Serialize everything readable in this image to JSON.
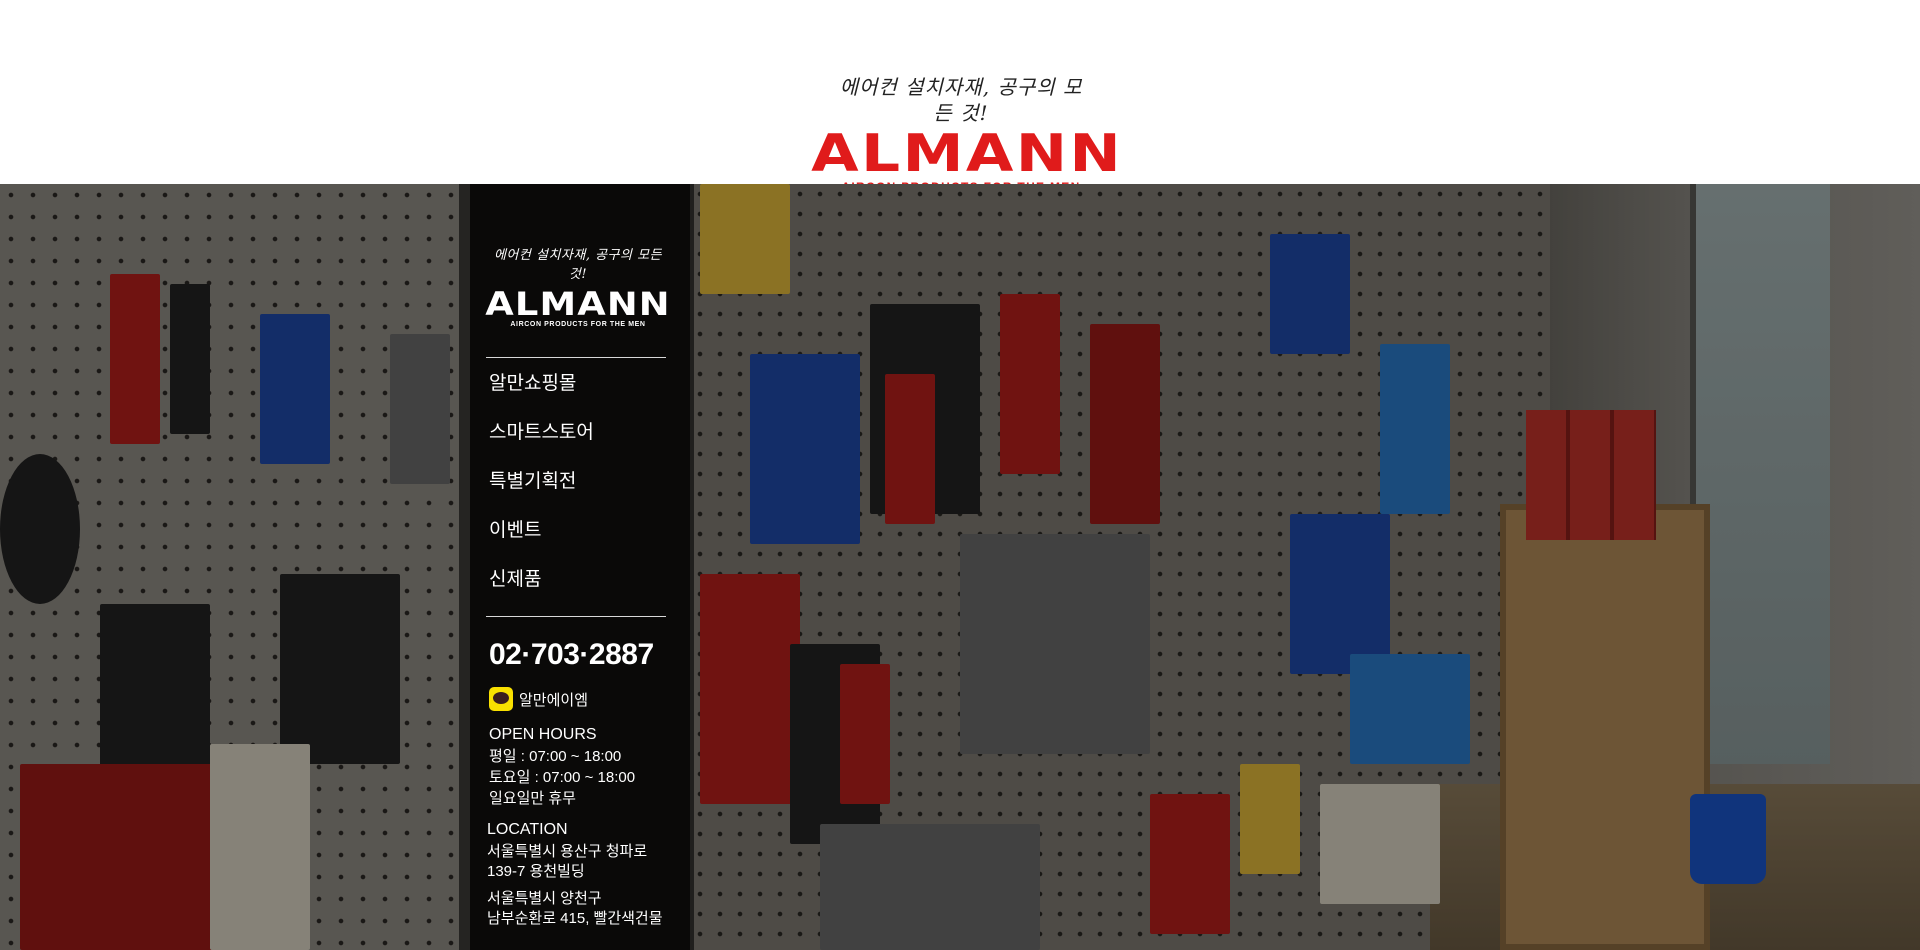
{
  "header": {
    "logo_tagline": "에어컨 설치자재, 공구의 모든 것!",
    "logo_wordmark": "ALMANN",
    "logo_subline": "AIRCON PRODUCTS FOR THE MEN"
  },
  "sidebar": {
    "logo_tagline": "에어컨 설치자재, 공구의 모든 것!",
    "logo_wordmark": "ALMANN",
    "logo_subline": "AIRCON PRODUCTS FOR THE MEN",
    "nav": [
      {
        "label": "알만쇼핑몰"
      },
      {
        "label": "스마트스토어"
      },
      {
        "label": "특별기획전"
      },
      {
        "label": "이벤트"
      },
      {
        "label": "신제품"
      }
    ],
    "phone": "02·703·2887",
    "kakao_label": "알만에이엠",
    "hours_title": "OPEN HOURS",
    "hours": [
      "평일 : 07:00 ~ 18:00",
      "토요일 : 07:00 ~ 18:00",
      "일요일만 휴무"
    ],
    "location_title": "LOCATION",
    "address1": [
      "서울특별시 용산구 청파로",
      "139-7 용천빌딩"
    ],
    "address2": [
      "서울특별시 양천구",
      "남부순환로 415, 빨간색건물"
    ]
  },
  "colors": {
    "brand_red": "#e01b1b",
    "kakao_yellow": "#f9e000",
    "panel_bg": "rgba(0,0,0,0.58)"
  }
}
